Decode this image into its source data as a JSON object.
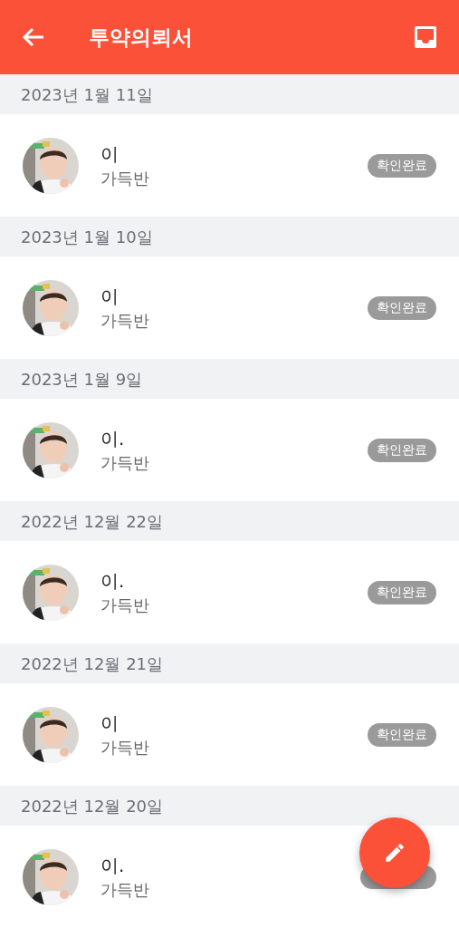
{
  "app_bar": {
    "title": "투약의뢰서"
  },
  "sections": [
    {
      "date": "2023년 1월 11일",
      "items": [
        {
          "kind": "picture",
          "name": "이",
          "class_name": "가득반",
          "badge": {
            "text": "확인완료"
          }
        }
      ]
    },
    {
      "date": "2023년 1월 10일",
      "items": [
        {
          "kind": "picture",
          "name": "이",
          "class_name": "가득반",
          "badge": {
            "text": "확인완료"
          }
        }
      ]
    },
    {
      "date": "2023년 1월 9일",
      "items": [
        {
          "kind": "picture",
          "name": "이.",
          "class_name": "가득반",
          "badge": {
            "text": "확인완료"
          }
        }
      ]
    },
    {
      "date": "2022년 12월 22일",
      "items": [
        {
          "kind": "picture",
          "name": "이.",
          "class_name": "가득반",
          "badge": {
            "text": "확인완료"
          }
        }
      ]
    },
    {
      "date": "2022년 12월 21일",
      "items": [
        {
          "kind": "picture",
          "name": "이",
          "class_name": "가득반",
          "badge": {
            "text": "확인완료"
          }
        }
      ]
    },
    {
      "date": "2022년 12월 20일",
      "items": [
        {
          "kind": "picture",
          "name": "이.",
          "class_name": "가득반",
          "badge": {
            "covered": true
          }
        }
      ]
    }
  ]
}
